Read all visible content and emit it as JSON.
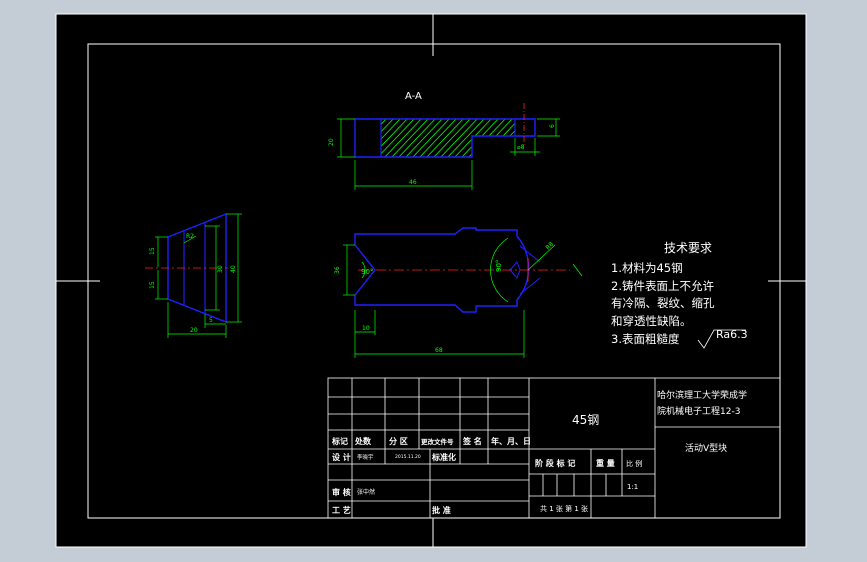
{
  "colors": {
    "background": "#000000",
    "frame": "#ffffff",
    "outline": "#2020ff",
    "dimension": "#00ff00",
    "centerline": "#ff2020",
    "hatch": "#00ff00",
    "text": "#ffffff"
  },
  "drawing": {
    "section_label": "A-A",
    "section_dims": {
      "height": "20",
      "length": "46",
      "bore": "⌀8",
      "step": "6"
    },
    "plan_dims": {
      "width": "36",
      "angle_left": "90°",
      "angle_right": "90°",
      "radius": "R8",
      "offset": "10",
      "length": "68"
    },
    "side_dims": {
      "chamfer": "R2",
      "height_outer": "40",
      "height_inner": "30",
      "upper_left": "15",
      "lower_left": "15",
      "small": "5",
      "width": "20"
    }
  },
  "tech": {
    "title": "技术要求",
    "lines": [
      "1.材料为45钢",
      "2.铸件表面上不允许",
      "有冷隔、裂纹、缩孔",
      "和穿透性缺陷。",
      "3.表面粗糙度"
    ],
    "roughness": "Ra6.3"
  },
  "title_block": {
    "material": "45钢",
    "school_line1": "哈尔滨理工大学荣成学",
    "school_line2": "院机械电子工程12-3",
    "part_name": "活动V型块",
    "headers": [
      "标记",
      "处数",
      "分 区",
      "更改文件号",
      "签 名",
      "年、月、日"
    ],
    "design_label": "设 计",
    "designer": "李晓宇",
    "date": "2015.11.20",
    "standardize_label": "标准化",
    "stage_headers": [
      "阶 段 标 记",
      "重 量",
      "比 例"
    ],
    "scale": "1:1",
    "review_label": "审 核",
    "reviewer": "张中然",
    "process_label": "工 艺",
    "approve_label": "批 准",
    "sheets": "共 1 张  第 1 张"
  }
}
